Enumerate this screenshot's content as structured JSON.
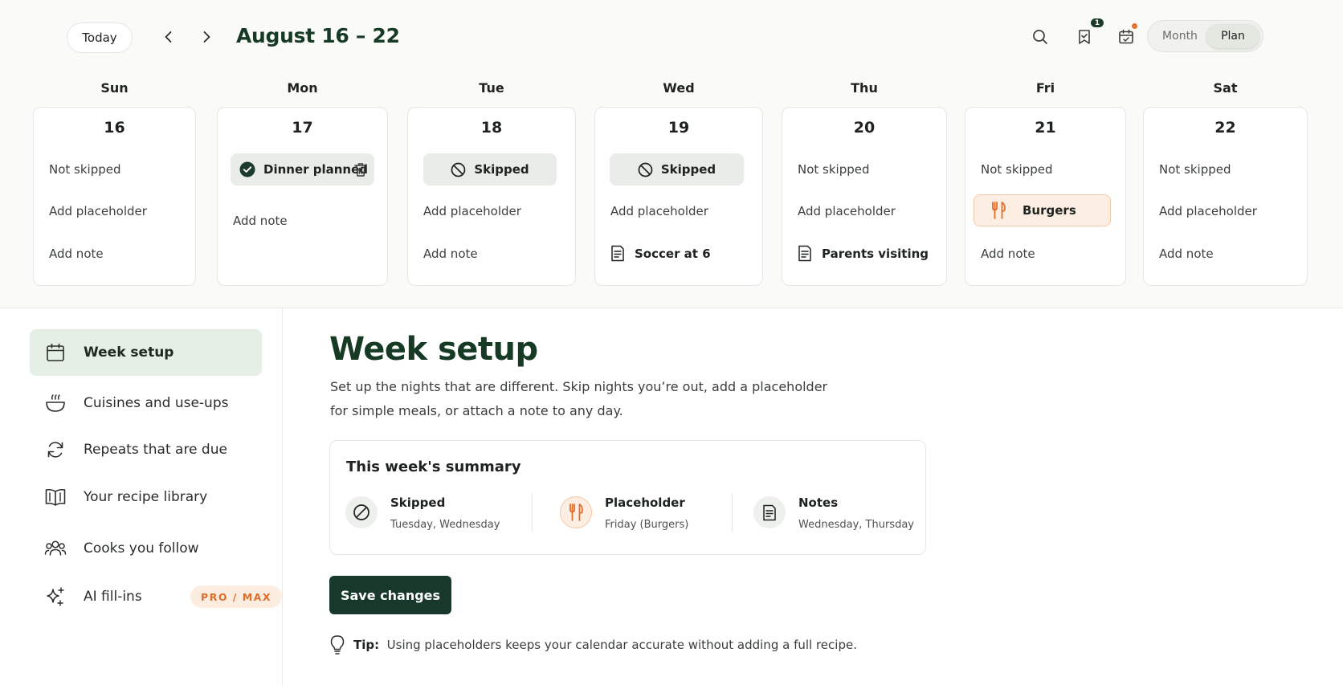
{
  "toolbar": {
    "today_label": "Today",
    "range_title": "August 16 – 22",
    "saved_badge_count": "1",
    "view_toggle": {
      "month_label": "Month",
      "plan_label": "Plan",
      "selected": "Plan"
    },
    "icons": [
      "chevron-left-icon",
      "chevron-right-icon",
      "search-icon",
      "bookmark-check-icon",
      "calendar-sync-icon"
    ]
  },
  "week": {
    "days": [
      {
        "name": "Sun",
        "date": "16",
        "line1": "Not skipped",
        "line2": "Add placeholder",
        "line3": "Add note"
      },
      {
        "name": "Mon",
        "date": "17",
        "status": "Dinner planned",
        "line2": "Add note"
      },
      {
        "name": "Tue",
        "date": "18",
        "status": "Skipped",
        "line2": "Add placeholder",
        "line3": "Add note"
      },
      {
        "name": "Wed",
        "date": "19",
        "status": "Skipped",
        "line2": "Add placeholder",
        "note": "Soccer at 6"
      },
      {
        "name": "Thu",
        "date": "20",
        "line1": "Not skipped",
        "line2": "Add placeholder",
        "note": "Parents visiting"
      },
      {
        "name": "Fri",
        "date": "21",
        "line1": "Not skipped",
        "placeholder": "Burgers",
        "line3": "Add note"
      },
      {
        "name": "Sat",
        "date": "22",
        "line1": "Not skipped",
        "line2": "Add placeholder",
        "line3": "Add note"
      }
    ]
  },
  "sidebar": {
    "items": [
      {
        "label": "Week setup",
        "icon": "calendar-icon",
        "active": true
      },
      {
        "label": "Cuisines and use-ups",
        "icon": "bowl-icon"
      },
      {
        "label": "Repeats that are due",
        "icon": "refresh-icon"
      },
      {
        "label": "Your recipe library",
        "icon": "book-icon"
      },
      {
        "label": "Cooks you follow",
        "icon": "people-icon"
      },
      {
        "label": "AI fill-ins",
        "icon": "sparkles-icon",
        "badge": "PRO / MAX"
      }
    ]
  },
  "main": {
    "title": "Week setup",
    "description": "Set up the nights that are different. Skip nights you’re out, add a placeholder for simple meals, or attach a note to any day.",
    "summary": {
      "title": "This week's summary",
      "skipped": {
        "label": "Skipped",
        "detail": "Tuesday, Wednesday"
      },
      "placeholder": {
        "label": "Placeholder",
        "detail": "Friday (Burgers)"
      },
      "notes": {
        "label": "Notes",
        "detail": "Wednesday, Thursday"
      }
    },
    "save_label": "Save changes",
    "tip_label": "Tip:",
    "tip_text": "Using placeholders keeps your calendar accurate without adding a full recipe."
  },
  "colors": {
    "brand_dark_green": "#17382a",
    "active_nav_bg": "#e6efe5",
    "placeholder_orange": "#e06e2b",
    "placeholder_bg": "#fdeee3"
  }
}
